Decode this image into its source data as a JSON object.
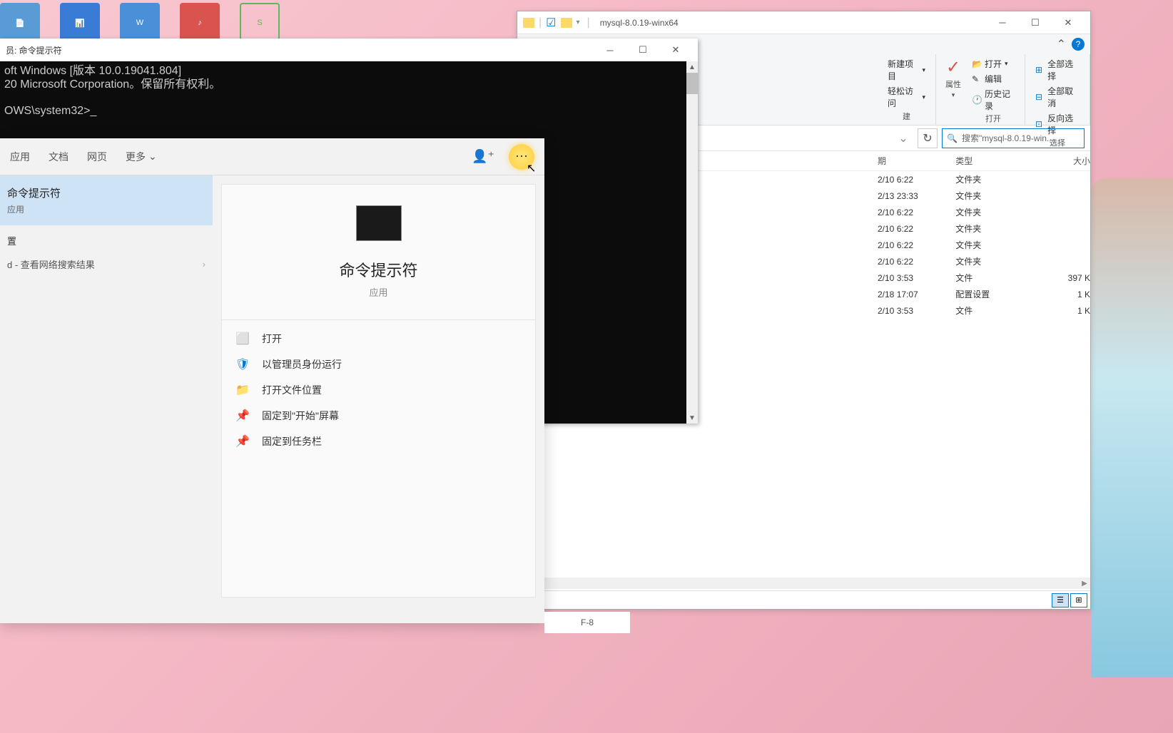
{
  "desktop_icons": [
    "📄",
    "📊",
    "W",
    "♪",
    "S"
  ],
  "explorer": {
    "title": "mysql-8.0.19-winx64",
    "ribbon": {
      "new_item": "新建项目",
      "easy_access": "轻松访问",
      "new_group": "建",
      "properties": "属性",
      "open": "打开",
      "edit": "编辑",
      "history": "历史记录",
      "open_group": "打开",
      "select_all": "全部选择",
      "select_none": "全部取消",
      "invert": "反向选择",
      "select_group": "选择"
    },
    "nav": {
      "search_placeholder": "搜索\"mysql-8.0.19-win..."
    },
    "columns": {
      "date": "期",
      "type": "类型",
      "size": "大小"
    },
    "rows": [
      {
        "date": "2/10 6:22",
        "type": "文件夹",
        "size": ""
      },
      {
        "date": "2/13 23:33",
        "type": "文件夹",
        "size": ""
      },
      {
        "date": "2/10 6:22",
        "type": "文件夹",
        "size": ""
      },
      {
        "date": "2/10 6:22",
        "type": "文件夹",
        "size": ""
      },
      {
        "date": "2/10 6:22",
        "type": "文件夹",
        "size": ""
      },
      {
        "date": "2/10 6:22",
        "type": "文件夹",
        "size": ""
      },
      {
        "date": "2/10 3:53",
        "type": "文件",
        "size": "397 K"
      },
      {
        "date": "2/18 17:07",
        "type": "配置设置",
        "size": "1 K"
      },
      {
        "date": "2/10 3:53",
        "type": "文件",
        "size": "1 K"
      }
    ]
  },
  "cmd": {
    "title": "员: 命令提示符",
    "line1": "oft Windows [版本 10.0.19041.804]",
    "line2": "20 Microsoft Corporation。保留所有权利。",
    "prompt": "OWS\\system32>_"
  },
  "search": {
    "tabs": {
      "app": "应用",
      "doc": "文档",
      "web": "网页",
      "more": "更多"
    },
    "best_match": {
      "title": "命令提示符",
      "sub": "应用"
    },
    "section_settings": "置",
    "web_result": "d - 查看网络搜索结果",
    "detail": {
      "title": "命令提示符",
      "sub": "应用"
    },
    "actions": {
      "open": "打开",
      "admin": "以管理员身份运行",
      "location": "打开文件位置",
      "pin_start": "固定到\"开始\"屏幕",
      "pin_task": "固定到任务栏"
    }
  },
  "bottom_fragment": "F-8"
}
